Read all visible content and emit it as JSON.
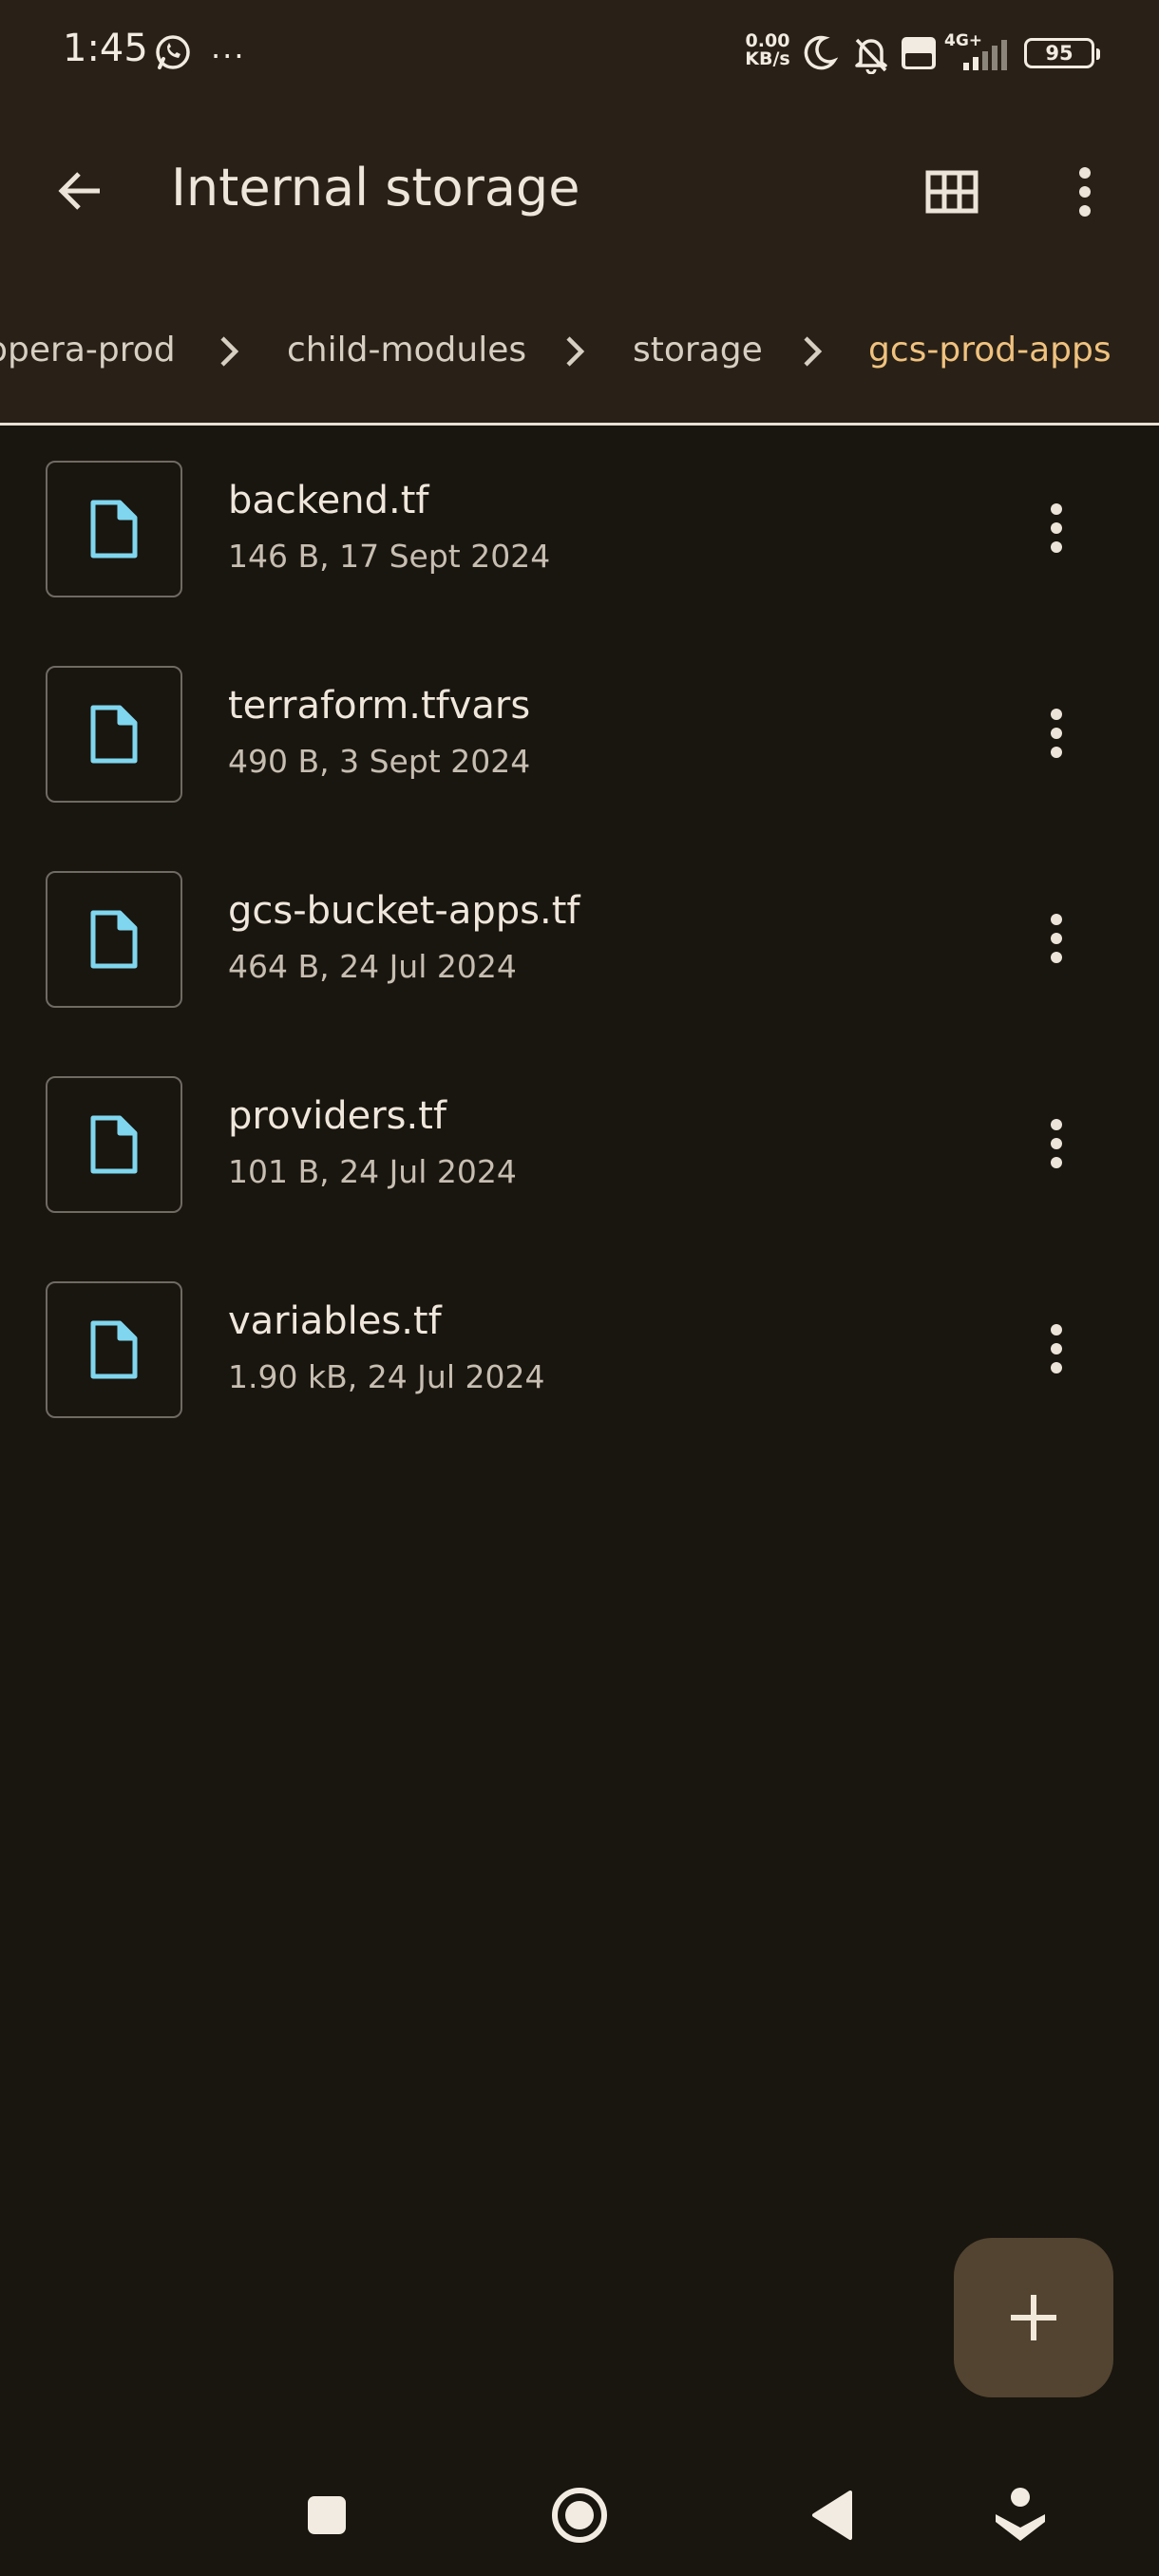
{
  "status_bar": {
    "time": "1:45",
    "net_speed_value": "0.00",
    "net_speed_unit": "KB/s",
    "network_type": "4G+",
    "battery": "95"
  },
  "app_bar": {
    "title": "Internal storage"
  },
  "breadcrumb": [
    {
      "label": "opera-prod"
    },
    {
      "label": "child-modules"
    },
    {
      "label": "storage"
    },
    {
      "label": "gcs-prod-apps"
    }
  ],
  "files": [
    {
      "name": "backend.tf",
      "meta": "146 B, 17 Sept 2024"
    },
    {
      "name": "terraform.tfvars",
      "meta": "490 B, 3 Sept 2024"
    },
    {
      "name": "gcs-bucket-apps.tf",
      "meta": "464 B, 24 Jul 2024"
    },
    {
      "name": "providers.tf",
      "meta": "101 B, 24 Jul 2024"
    },
    {
      "name": "variables.tf",
      "meta": "1.90 kB, 24 Jul 2024"
    }
  ],
  "colors": {
    "accent": "#f0c27f",
    "file_icon": "#7fd6ee",
    "fab": "#524430",
    "header": "#292117",
    "background": "#19150f"
  }
}
